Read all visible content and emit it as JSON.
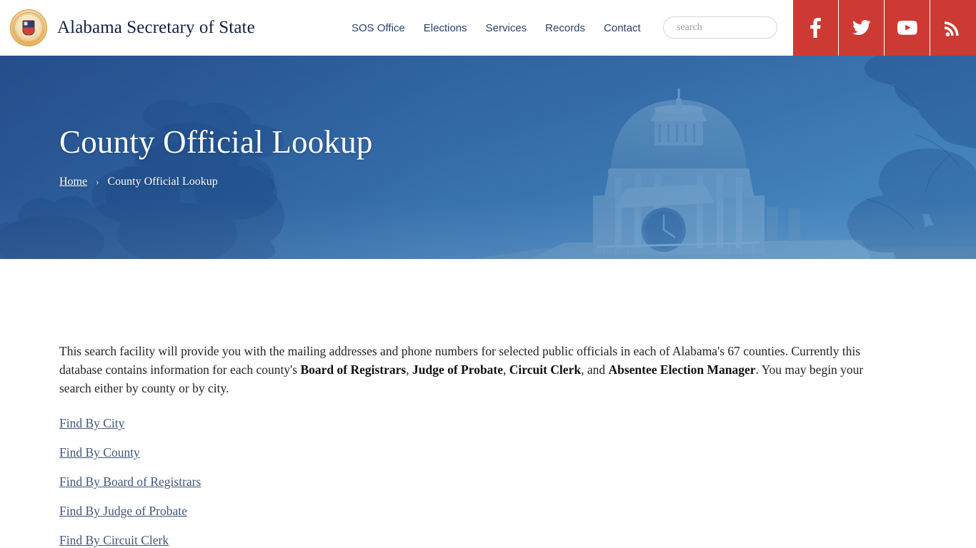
{
  "header": {
    "brand_title": "Alabama Secretary of State",
    "seal_icon": "alabama-state-seal-icon",
    "nav": [
      {
        "label": "SOS Office"
      },
      {
        "label": "Elections"
      },
      {
        "label": "Services"
      },
      {
        "label": "Records"
      },
      {
        "label": "Contact"
      }
    ],
    "search": {
      "placeholder": "search",
      "value": ""
    },
    "social": [
      {
        "name": "facebook",
        "label": "Facebook"
      },
      {
        "name": "twitter",
        "label": "Twitter"
      },
      {
        "name": "youtube",
        "label": "YouTube"
      },
      {
        "name": "rss",
        "label": "RSS"
      }
    ]
  },
  "hero": {
    "title": "County Official Lookup",
    "breadcrumb": {
      "home_label": "Home",
      "separator": "›",
      "current_label": "County Official Lookup"
    },
    "background_image": "alabama-state-capitol-dome-with-trees"
  },
  "main": {
    "intro": {
      "part1": "This search facility will provide you with the mailing addresses and phone numbers for selected public officials in each of Alabama's 67 counties.  Currently this database contains information for each county's ",
      "bold1": "Board of Registrars",
      "sep1": ", ",
      "bold2": "Judge of Probate",
      "sep2": ", ",
      "bold3": "Circuit Clerk",
      "sep3": ", and ",
      "bold4": "Absentee Election Manager",
      "part2": ".  You may begin your search either by county or by city."
    },
    "links": [
      {
        "label": "Find By City"
      },
      {
        "label": "Find By County"
      },
      {
        "label": "Find By Board of Registrars"
      },
      {
        "label": "Find By Judge of Probate"
      },
      {
        "label": "Find By Circuit Clerk"
      }
    ]
  },
  "colors": {
    "brand_red": "#cc3a33",
    "nav_blue": "#2c4270",
    "hero_blue": "#3467a4",
    "link_blue": "#41567a",
    "title_navy": "#132043"
  }
}
